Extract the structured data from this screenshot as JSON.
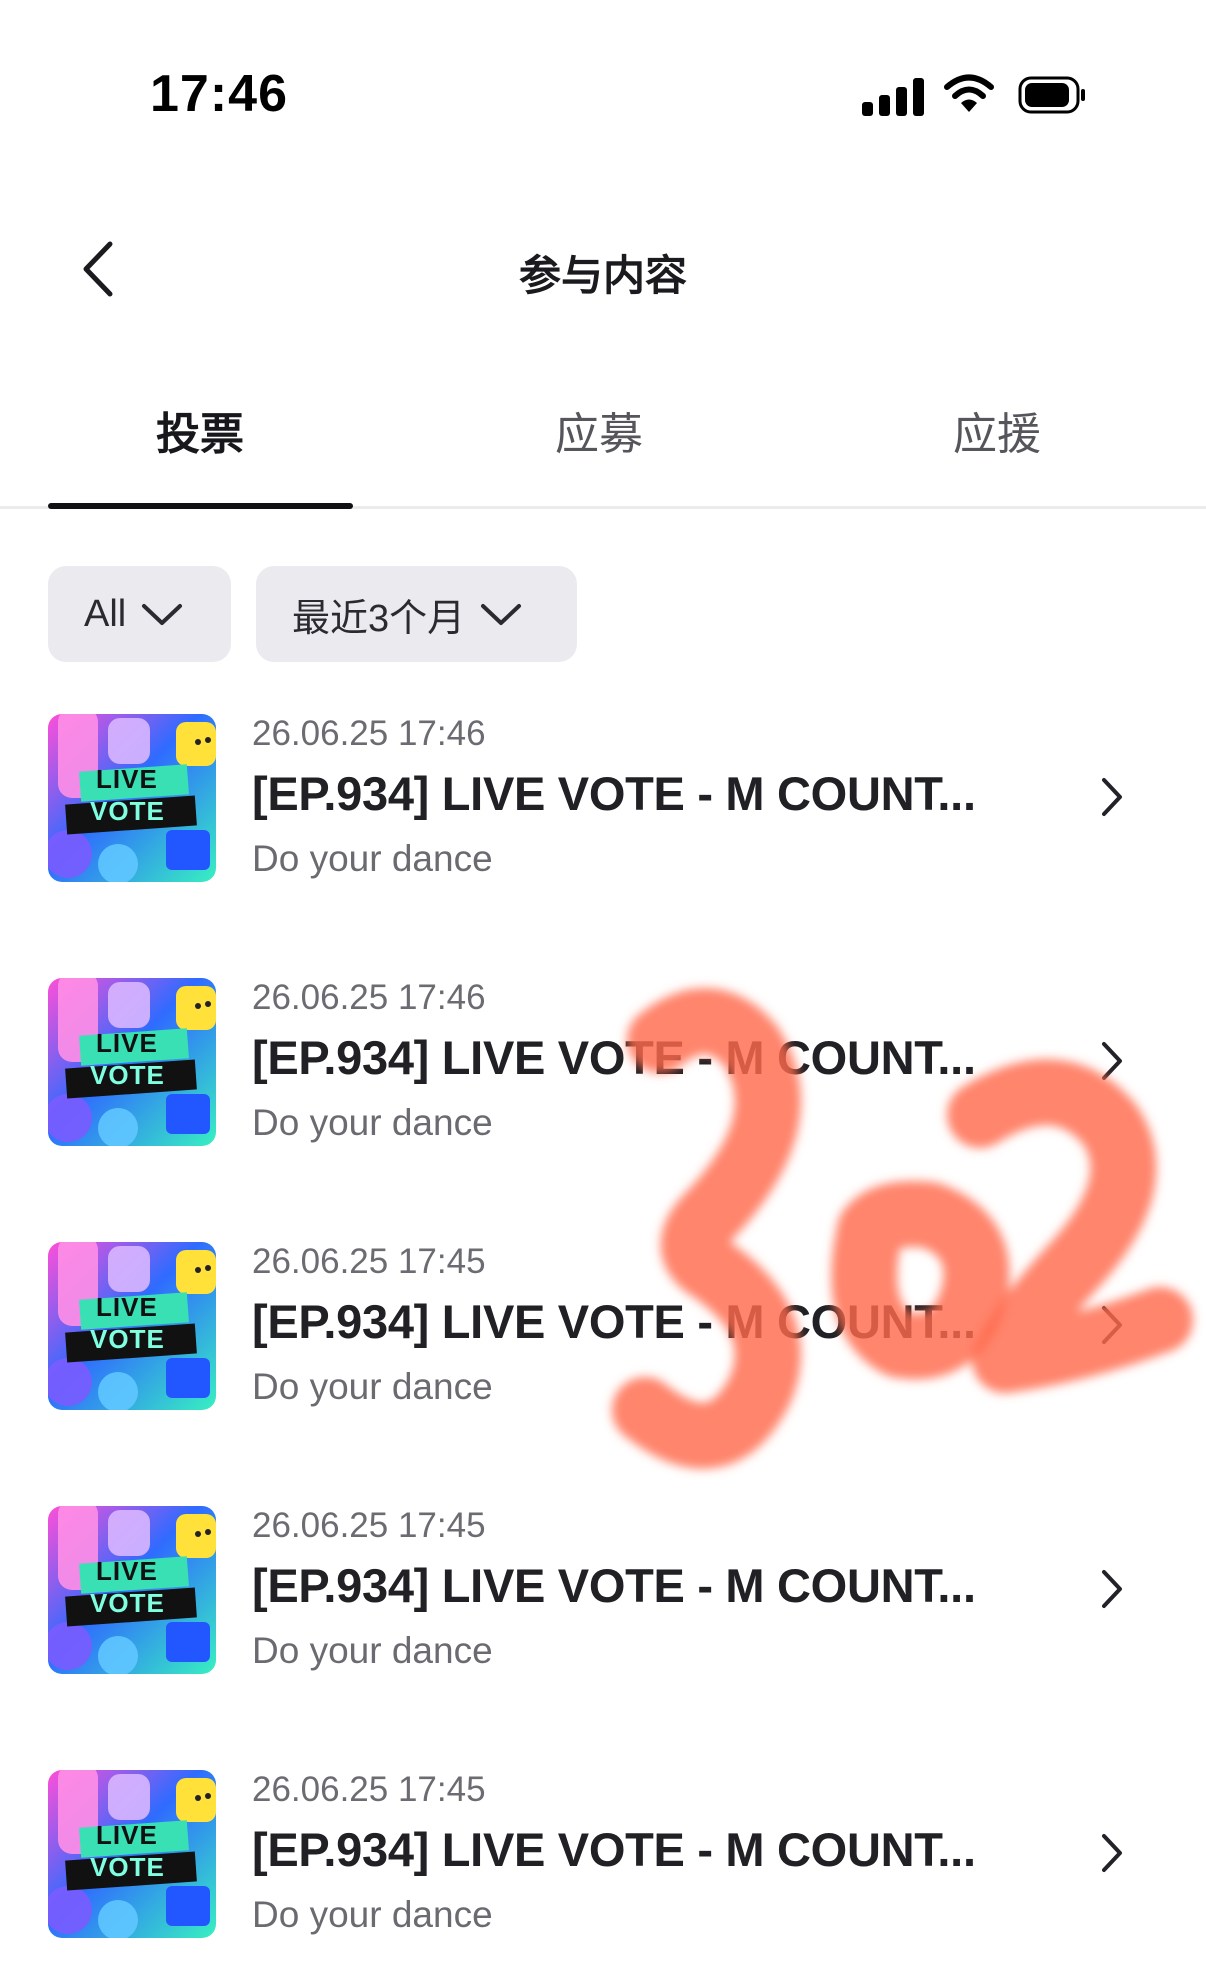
{
  "status_bar": {
    "time": "17:46",
    "signal_icon": "cellular-signal-icon",
    "wifi_icon": "wifi-icon",
    "battery_icon": "battery-icon"
  },
  "nav": {
    "title": "参与内容",
    "back_icon": "chevron-left-icon"
  },
  "tabs": [
    {
      "label": "投票",
      "active": true
    },
    {
      "label": "应募",
      "active": false
    },
    {
      "label": "应援",
      "active": false
    }
  ],
  "filters": [
    {
      "label": "All",
      "icon": "chevron-down-icon"
    },
    {
      "label": "最近3个月",
      "icon": "chevron-down-icon"
    }
  ],
  "items": [
    {
      "date": "26.06.25 17:46",
      "title": "[EP.934] LIVE VOTE - M COUNT...",
      "subtitle": "Do your dance",
      "thumb_text": [
        "LIVE",
        "VOTE"
      ]
    },
    {
      "date": "26.06.25 17:46",
      "title": "[EP.934] LIVE VOTE - M COUNT...",
      "subtitle": "Do your dance",
      "thumb_text": [
        "LIVE",
        "VOTE"
      ]
    },
    {
      "date": "26.06.25 17:45",
      "title": "[EP.934] LIVE VOTE - M COUNT...",
      "subtitle": "Do your dance",
      "thumb_text": [
        "LIVE",
        "VOTE"
      ]
    },
    {
      "date": "26.06.25 17:45",
      "title": "[EP.934] LIVE VOTE - M COUNT...",
      "subtitle": "Do your dance",
      "thumb_text": [
        "LIVE",
        "VOTE"
      ]
    },
    {
      "date": "26.06.25 17:45",
      "title": "[EP.934] LIVE VOTE - M COUNT...",
      "subtitle": "Do your dance",
      "thumb_text": [
        "LIVE",
        "VOTE"
      ]
    }
  ],
  "overlay": {
    "handwritten_text": "302",
    "color": "#ff6a4d"
  },
  "colors": {
    "tab_indicator": "#111114",
    "chip_background": "#ebebef",
    "thumb_gradient_start": "#2f6bff",
    "thumb_gradient_end": "#38f0c0"
  }
}
